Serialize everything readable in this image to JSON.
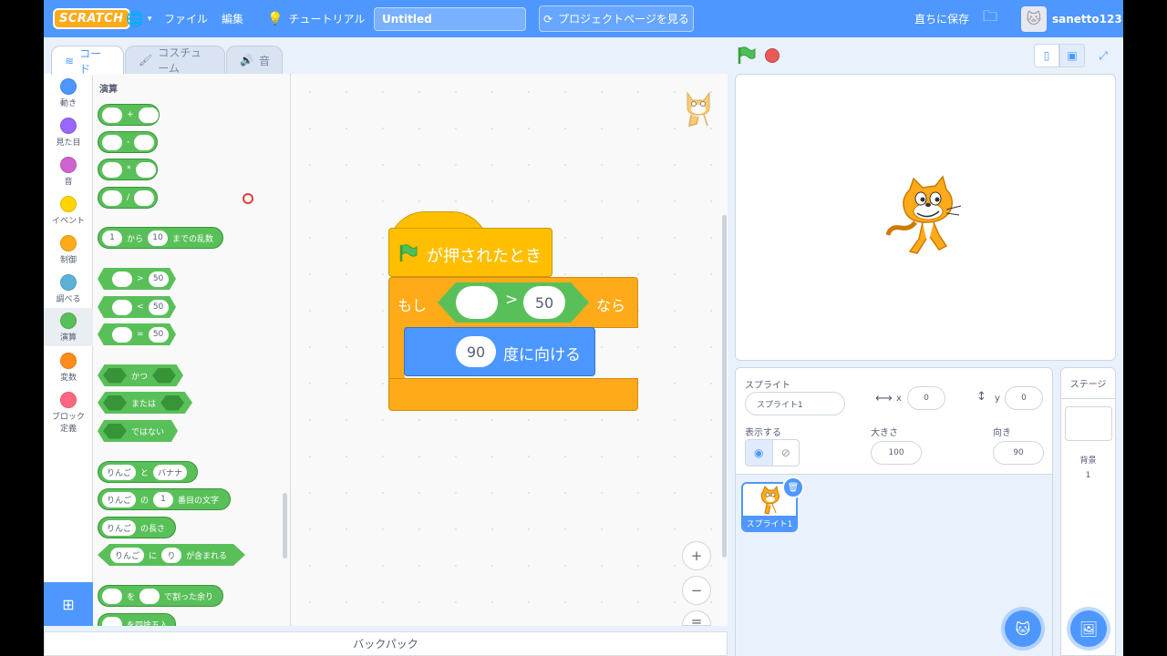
{
  "menubar": {
    "logo": "SCRATCH",
    "file": "ファイル",
    "edit": "編集",
    "tutorial": "チュートリアル",
    "project_title": "Untitled",
    "project_page": "プロジェクトページを見る",
    "save_now": "直ちに保存",
    "username": "sanetto123"
  },
  "tabs": {
    "code": "コード",
    "costumes": "コスチューム",
    "sounds": "音"
  },
  "categories": [
    {
      "label": "動き",
      "color": "#4c97ff"
    },
    {
      "label": "見た目",
      "color": "#9966ff"
    },
    {
      "label": "音",
      "color": "#cf63cf"
    },
    {
      "label": "イベント",
      "color": "#ffd500"
    },
    {
      "label": "制御",
      "color": "#ffab19"
    },
    {
      "label": "調べる",
      "color": "#5cb1d6"
    },
    {
      "label": "演算",
      "color": "#59c059"
    },
    {
      "label": "変数",
      "color": "#ff8c1a"
    },
    {
      "label": "ブロック定義",
      "color": "#ff6680"
    }
  ],
  "palette": {
    "section_title": "演算",
    "ops": [
      "+",
      "-",
      "*",
      "/"
    ],
    "random": {
      "from": "1",
      "to_label": "から",
      "to": "10",
      "suffix": "までの乱数"
    },
    "compare": [
      {
        "op": ">",
        "value": "50"
      },
      {
        "op": "<",
        "value": "50"
      },
      {
        "op": "=",
        "value": "50"
      }
    ],
    "and": "かつ",
    "or": "または",
    "not": "ではない",
    "join": {
      "a": "りんご",
      "and": "と",
      "b": "バナナ"
    },
    "letter_of": {
      "text": "りんご",
      "of": "の",
      "index": "1",
      "suffix": "番目の文字"
    },
    "length": {
      "text": "りんご",
      "suffix": "の長さ"
    },
    "contains": {
      "text": "りんご",
      "in": "に",
      "value": "り",
      "suffix": "が含まれる"
    },
    "mod": {
      "of": "を",
      "suffix": "で割った余り"
    },
    "round": "を四捨五入"
  },
  "script": {
    "hat_label": "が押されたとき",
    "if_label": "もし",
    "then_label": "なら",
    "compare_op": ">",
    "compare_value": "50",
    "motion_value": "90",
    "motion_label": "度に向ける"
  },
  "zoom": {
    "in": "+",
    "out": "−",
    "reset": "="
  },
  "backpack": "バックパック",
  "sprite_info": {
    "sprite_label": "スプライト",
    "sprite_name": "スプライト1",
    "x_label": "x",
    "x": "0",
    "y_label": "y",
    "y": "0",
    "show_label": "表示する",
    "size_label": "大きさ",
    "size": "100",
    "direction_label": "向き",
    "direction": "90"
  },
  "sprites": [
    {
      "name": "スプライト1"
    }
  ],
  "stage_pane": {
    "title": "ステージ",
    "backdrop_label": "背景",
    "backdrop_count": "1"
  },
  "colors": {
    "menubar": "#4d97ff",
    "operators": "#59c059",
    "events": "#ffbf00",
    "control": "#ffab19",
    "motion": "#4c97ff"
  }
}
